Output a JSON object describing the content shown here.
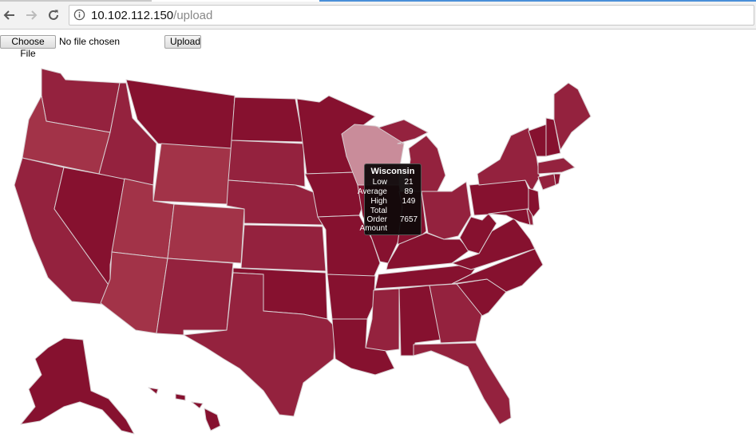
{
  "browser": {
    "url_host": "10.102.112.150",
    "url_path": "/upload",
    "back_icon": "arrow-left-icon",
    "forward_icon": "arrow-right-icon",
    "reload_icon": "reload-icon",
    "info_icon": "info-icon"
  },
  "form": {
    "choose_file_label": "Choose File",
    "no_file_text": "No file chosen",
    "upload_label": "Upload"
  },
  "map": {
    "colors": {
      "dark": "#86112f",
      "medium": "#94223e",
      "light": "#a23348",
      "highlight": "#c98c9a"
    },
    "highlighted_state": "Wisconsin"
  },
  "tooltip": {
    "title": "Wisconsin",
    "rows": [
      {
        "label": "Low",
        "value": "21"
      },
      {
        "label": "Average",
        "value": "89"
      },
      {
        "label": "High",
        "value": "149"
      },
      {
        "label": "Total",
        "value": ""
      },
      {
        "label": "Order",
        "value": "7657"
      },
      {
        "label": "Amount",
        "value": ""
      }
    ]
  }
}
